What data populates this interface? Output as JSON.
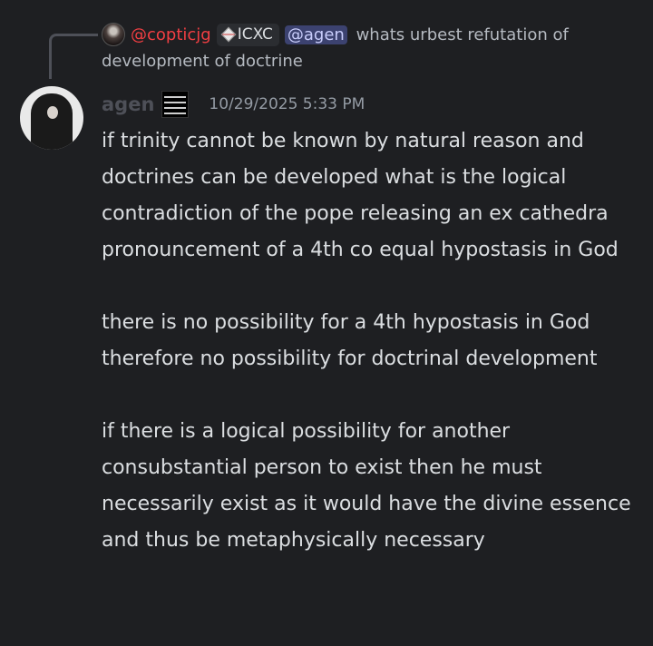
{
  "reply": {
    "author": "@copticjg",
    "tag": "ICXC",
    "mention": "@agen",
    "text": "whats urbest refutation of development of doctrine"
  },
  "message": {
    "username": "agen",
    "timestamp": "10/29/2025 5:33 PM",
    "paragraphs": [
      "if trinity cannot be known by natural reason and doctrines can be developed what is the logical contradiction of the pope releasing an ex cathedra pronouncement of a 4th co equal hypostasis in God",
      "there is no possibility for a 4th hypostasis in God therefore no possibility for doctrinal development",
      "if there is a logical possibility for another consubstantial person to exist then he must necessarily exist as it would have the divine essence and thus be metaphysically necessary"
    ]
  },
  "colors": {
    "background": "#1e1f22",
    "reply_author": "#f23f43",
    "mention_bg": "#3c4270",
    "mention_text": "#c9cdfb",
    "username": "#4e5058",
    "timestamp": "#949ba4",
    "text": "#dbdee1"
  }
}
